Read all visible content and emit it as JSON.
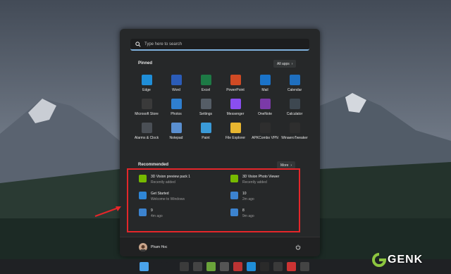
{
  "search": {
    "placeholder": "Type here to search",
    "icon": "search-icon"
  },
  "pinned": {
    "title": "Pinned",
    "all_apps_label": "All apps",
    "apps": [
      {
        "label": "Edge",
        "icon": "edge-icon",
        "color": "#1f8ed8"
      },
      {
        "label": "Word",
        "icon": "word-icon",
        "color": "#2b5cb8"
      },
      {
        "label": "Excel",
        "icon": "excel-icon",
        "color": "#1d7a45"
      },
      {
        "label": "PowerPoint",
        "icon": "powerpoint-icon",
        "color": "#d04a24"
      },
      {
        "label": "Mail",
        "icon": "mail-icon",
        "color": "#1a73c9"
      },
      {
        "label": "Calendar",
        "icon": "calendar-icon",
        "color": "#1e6fbf"
      },
      {
        "label": "Microsoft Store",
        "icon": "store-icon",
        "color": "#3a3a3a"
      },
      {
        "label": "Photos",
        "icon": "photos-icon",
        "color": "#2f7fcf"
      },
      {
        "label": "Settings",
        "icon": "settings-icon",
        "color": "#555d66"
      },
      {
        "label": "Messenger",
        "icon": "messenger-icon",
        "color": "#8a4ef0"
      },
      {
        "label": "OneNote",
        "icon": "onenote-icon",
        "color": "#7b3aa8"
      },
      {
        "label": "Calculator",
        "icon": "calculator-icon",
        "color": "#3d4750"
      },
      {
        "label": "Alarms & Clock",
        "icon": "clock-icon",
        "color": "#4a4f55"
      },
      {
        "label": "Notepad",
        "icon": "notepad-icon",
        "color": "#5a8fd0"
      },
      {
        "label": "Paint",
        "icon": "paint-icon",
        "color": "#3a9ad8"
      },
      {
        "label": "File Explorer",
        "icon": "folder-icon",
        "color": "#e8b630"
      },
      {
        "label": "APKCombo VPN",
        "icon": "android-icon",
        "color": "#2e2e2e"
      },
      {
        "label": "WinaeroTweaker",
        "icon": "tweaker-icon",
        "color": "#2e2e2e"
      }
    ]
  },
  "recommended": {
    "title": "Recommended",
    "more_label": "More",
    "items": [
      {
        "title": "3D Vision preview pack 1",
        "sub": "Recently added",
        "icon": "nvidia-icon",
        "color": "#76b900"
      },
      {
        "title": "3D Vision Photo Viewer",
        "sub": "Recently added",
        "icon": "nvidia-icon",
        "color": "#76b900"
      },
      {
        "title": "Get Started",
        "sub": "Welcome to Windows",
        "icon": "tips-icon",
        "color": "#2f86d6"
      },
      {
        "title": "10",
        "sub": "2m ago",
        "icon": "image-file-icon",
        "color": "#3c83cf"
      },
      {
        "title": "9",
        "sub": "4m ago",
        "icon": "image-file-icon",
        "color": "#3c83cf"
      },
      {
        "title": "8",
        "sub": "9m ago",
        "icon": "image-file-icon",
        "color": "#3c83cf"
      }
    ]
  },
  "user": {
    "name": "Pham Hoc",
    "power_icon": "power-icon"
  },
  "taskbar": {
    "items": [
      {
        "icon": "windows-start-icon",
        "color": "#4aa3ec"
      },
      {
        "icon": "search-icon",
        "color": "#1f2124"
      },
      {
        "icon": "task-view-icon",
        "color": "#1f2124"
      },
      {
        "icon": "app-icon",
        "color": "#3b3b3b"
      },
      {
        "icon": "app-icon",
        "color": "#444"
      },
      {
        "icon": "vim-icon",
        "color": "#6aa33a"
      },
      {
        "icon": "app-icon",
        "color": "#555"
      },
      {
        "icon": "app-icon",
        "color": "#b33"
      },
      {
        "icon": "edge-icon",
        "color": "#1f8ed8"
      },
      {
        "icon": "chrome-icon",
        "color": "#2a2a2a"
      },
      {
        "icon": "app-icon",
        "color": "#3a3a3a"
      },
      {
        "icon": "app-icon",
        "color": "#c33"
      },
      {
        "icon": "app-icon",
        "color": "#444"
      }
    ]
  },
  "watermark": {
    "text": "GENK"
  }
}
